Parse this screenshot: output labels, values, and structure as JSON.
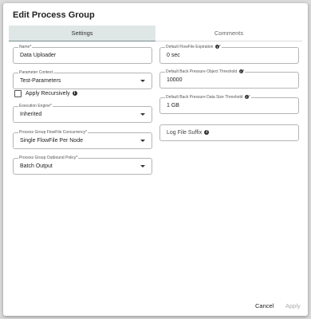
{
  "dialog": {
    "title": "Edit Process Group"
  },
  "tabs": [
    {
      "label": "Settings",
      "active": true
    },
    {
      "label": "Comments",
      "active": false
    }
  ],
  "left_fields": {
    "name": {
      "label": "Name*",
      "value": "Data Uploader"
    },
    "parameter_context": {
      "label": "Parameter Context",
      "value": "Test-Parameters"
    },
    "apply_recursively": {
      "label": "Apply Recursively",
      "checked": false
    },
    "execution_engine": {
      "label": "Execution Engine*",
      "value": "Inherited"
    },
    "flowfile_concurrency": {
      "label": "Process Group FlowFile Concurrency*",
      "value": "Single FlowFile Per Node"
    },
    "outbound_policy": {
      "label": "Process Group Outbound Policy*",
      "value": "Batch Output"
    }
  },
  "right_fields": {
    "flowfile_expiration": {
      "label": "Default FlowFile Expiration",
      "value": "0 sec"
    },
    "back_pressure_object": {
      "label": "Default Back Pressure Object Threshold",
      "value": "10000"
    },
    "back_pressure_size": {
      "label": "Default Back Pressure Data Size Threshold",
      "value": "1 GB"
    },
    "log_file_suffix": {
      "placeholder": "Log File Suffix"
    }
  },
  "footer": {
    "cancel_label": "Cancel",
    "apply_label": "Apply"
  },
  "colors": {
    "active_tab_bg": "#dfe6e6",
    "disabled_text": "#aaaaaa",
    "field_border": "#b5b5b5"
  },
  "icons": [
    "info-icon",
    "chevron-down-icon",
    "checkbox"
  ]
}
